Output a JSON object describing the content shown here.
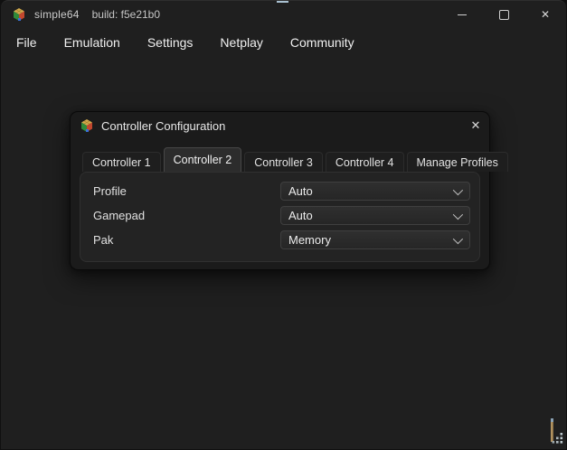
{
  "window": {
    "app_name": "simple64",
    "build_label": "build: f5e21b0",
    "controls": {
      "close_glyph": "✕"
    }
  },
  "menubar": {
    "items": [
      "File",
      "Emulation",
      "Settings",
      "Netplay",
      "Community"
    ]
  },
  "dialog": {
    "title": "Controller Configuration",
    "close_glyph": "✕",
    "tabs": [
      {
        "label": "Controller 1",
        "active": false
      },
      {
        "label": "Controller 2",
        "active": true
      },
      {
        "label": "Controller 3",
        "active": false
      },
      {
        "label": "Controller 4",
        "active": false
      },
      {
        "label": "Manage Profiles",
        "active": false
      }
    ],
    "fields": [
      {
        "label": "Profile",
        "value": "Auto"
      },
      {
        "label": "Gamepad",
        "value": "Auto"
      },
      {
        "label": "Pak",
        "value": "Memory"
      }
    ]
  },
  "icons": {
    "app_logo": "simple64-cube-logo",
    "minimize": "minimize-icon",
    "maximize": "maximize-icon",
    "close": "close-icon",
    "dropdown_arrow": "chevron-down-icon",
    "size_grip": "resize-grip-icon"
  },
  "colors": {
    "window_bg": "#1f1f1f",
    "dialog_bg": "#1b1b1b",
    "pane_bg": "#232323",
    "combo_bg": "#2a2a2a",
    "tab_active_bg": "#2c2c2c",
    "text": "#e8e8e8",
    "muted_text": "#c4c4c4"
  }
}
